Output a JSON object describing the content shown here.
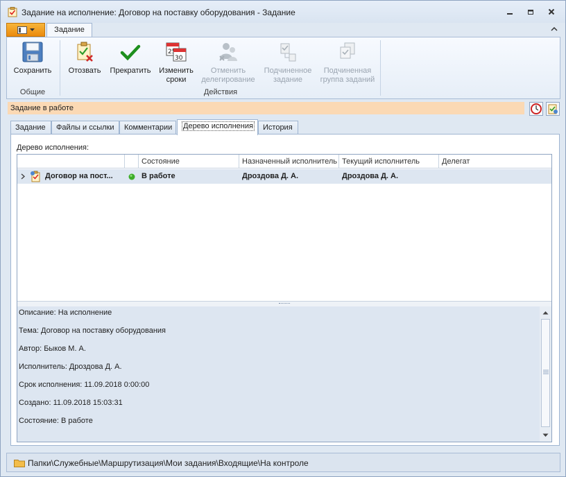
{
  "window": {
    "title": "Задание на исполнение: Договор на поставку оборудования - Задание"
  },
  "ribbon": {
    "tab_label": "Задание",
    "groups": {
      "general": {
        "label": "Общие",
        "save_label": "Сохранить"
      },
      "actions": {
        "label": "Действия",
        "recall_label": "Отозвать",
        "stop_label": "Прекратить",
        "change_dates_label_1": "Изменить",
        "change_dates_label_2": "сроки",
        "cancel_delegation_label_1": "Отменить",
        "cancel_delegation_label_2": "делегирование",
        "subtask_label_1": "Подчиненное",
        "subtask_label_2": "задание",
        "subgroup_label_1": "Подчиненная",
        "subgroup_label_2": "группа заданий"
      }
    }
  },
  "status_strip": {
    "text": "Задание в работе"
  },
  "tabs": [
    {
      "label": "Задание"
    },
    {
      "label": "Файлы и ссылки"
    },
    {
      "label": "Комментарии"
    },
    {
      "label": "Дерево исполнения"
    },
    {
      "label": "История"
    }
  ],
  "active_tab": "Дерево исполнения",
  "tree": {
    "caption": "Дерево исполнения:",
    "columns": {
      "state": "Состояние",
      "assigned": "Назначенный исполнитель",
      "current": "Текущий исполнитель",
      "delegate": "Делегат"
    },
    "rows": [
      {
        "name": "Договор на пост...",
        "state": "В работе",
        "assigned": "Дроздова Д. А.",
        "current": "Дроздова Д. А.",
        "delegate": ""
      }
    ]
  },
  "details": {
    "description": "Описание: На исполнение",
    "subject": "Тема: Договор на поставку оборудования",
    "author": "Автор: Быков М. А.",
    "performer": "Исполнитель: Дроздова Д. А.",
    "deadline": "Срок исполнения: 11.09.2018 0:00:00",
    "created": "Создано: 11.09.2018 15:03:31",
    "state": "Состояние: В работе"
  },
  "footer": {
    "path": "Папки\\Служебные\\Маршрутизация\\Мои задания\\Входящие\\На контроле"
  },
  "colors": {
    "status_strip_bg": "#fbd9b4",
    "app_menu_orange": "#f0a020",
    "state_ok_green": "#3fae2a"
  }
}
